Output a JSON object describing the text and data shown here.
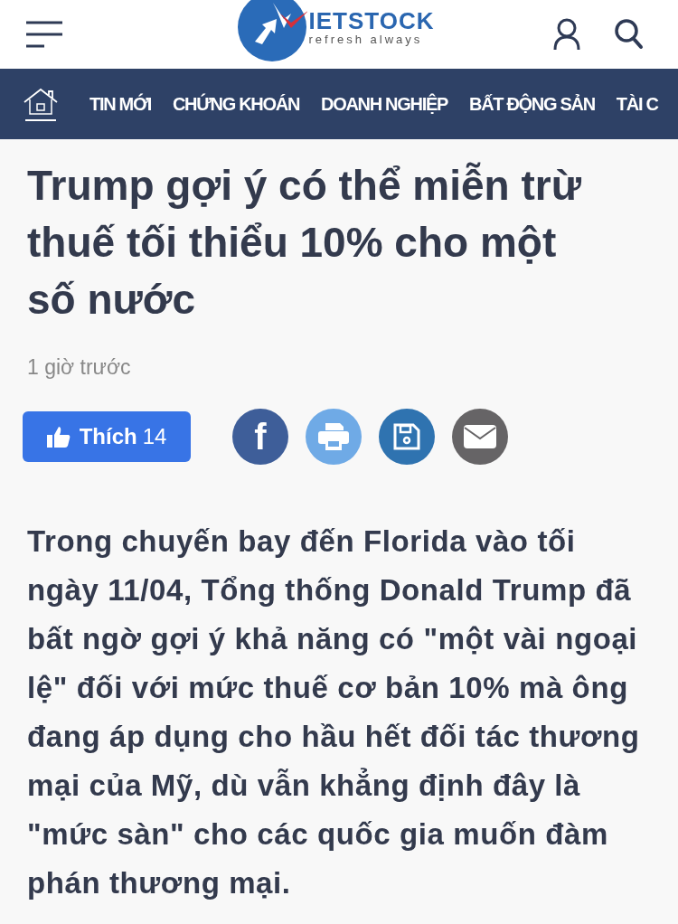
{
  "header": {
    "logo_text": "IETSTOCK",
    "logo_tagline": "refresh always"
  },
  "nav": {
    "items": [
      {
        "label": "TIN MỚI"
      },
      {
        "label": "CHỨNG KHOÁN"
      },
      {
        "label": "DOANH NGHIỆP"
      },
      {
        "label": "BẤT ĐỘNG SẢN"
      },
      {
        "label": "TÀI C"
      }
    ]
  },
  "article": {
    "title": "Trump gợi ý có thể miễn trừ thuế tối thiểu 10% cho một số nước",
    "time": "1 giờ trước",
    "like": {
      "label": "Thích",
      "count": "14"
    },
    "share": [
      {
        "kind": "facebook",
        "text": "f"
      },
      {
        "kind": "print"
      },
      {
        "kind": "save"
      },
      {
        "kind": "email"
      }
    ],
    "body": "Trong chuyến bay đến Florida vào tối ngày 11/04, Tổng thống Donald Trump đã bất ngờ gợi ý khả năng có \"một vài ngoại lệ\" đối với mức thuế cơ bản 10% mà ông đang áp dụng cho hầu hết đối tác thương mại của Mỹ, dù vẫn khẳng định đây là \"mức sàn\" cho các quốc gia muốn đàm phán thương mại."
  }
}
